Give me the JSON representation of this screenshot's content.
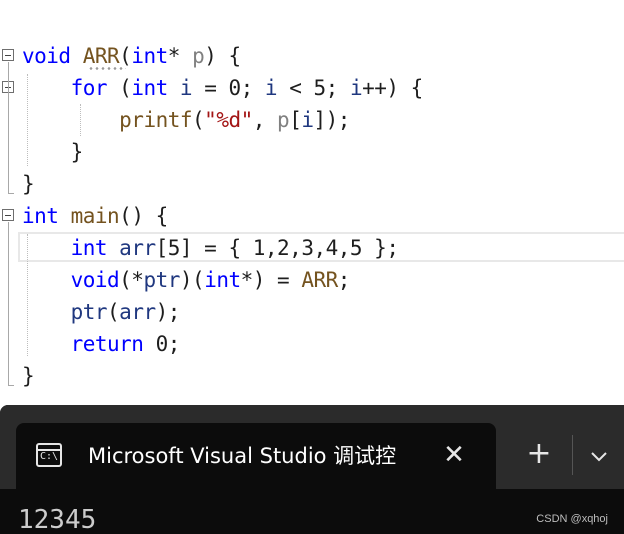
{
  "editor": {
    "lines": [
      {
        "tokens": [
          {
            "t": "void",
            "c": "kw"
          },
          {
            "t": " "
          },
          {
            "t": "ARR",
            "c": "fn"
          },
          {
            "t": "("
          },
          {
            "t": "int",
            "c": "kw"
          },
          {
            "t": "* "
          },
          {
            "t": "p",
            "c": "par"
          },
          {
            "t": ") {"
          }
        ]
      },
      {
        "tokens": [
          {
            "t": "    "
          },
          {
            "t": "for",
            "c": "kw"
          },
          {
            "t": " ("
          },
          {
            "t": "int",
            "c": "kw"
          },
          {
            "t": " "
          },
          {
            "t": "i",
            "c": "var"
          },
          {
            "t": " = 0; "
          },
          {
            "t": "i",
            "c": "var"
          },
          {
            "t": " < 5; "
          },
          {
            "t": "i",
            "c": "var"
          },
          {
            "t": "++) {"
          }
        ]
      },
      {
        "tokens": [
          {
            "t": "        "
          },
          {
            "t": "printf",
            "c": "fn"
          },
          {
            "t": "("
          },
          {
            "t": "\"%d\"",
            "c": "str"
          },
          {
            "t": ", "
          },
          {
            "t": "p",
            "c": "par"
          },
          {
            "t": "["
          },
          {
            "t": "i",
            "c": "var"
          },
          {
            "t": "]);"
          }
        ]
      },
      {
        "tokens": [
          {
            "t": "    }"
          }
        ]
      },
      {
        "tokens": [
          {
            "t": "}"
          }
        ]
      },
      {
        "tokens": [
          {
            "t": "int",
            "c": "kw"
          },
          {
            "t": " "
          },
          {
            "t": "main",
            "c": "fn"
          },
          {
            "t": "() {"
          }
        ]
      },
      {
        "tokens": [
          {
            "t": "    "
          },
          {
            "t": "int",
            "c": "kw"
          },
          {
            "t": " "
          },
          {
            "t": "arr",
            "c": "var"
          },
          {
            "t": "[5] = { 1,2,3,4,5 };"
          }
        ]
      },
      {
        "tokens": [
          {
            "t": "    "
          },
          {
            "t": "void",
            "c": "kw"
          },
          {
            "t": "(*"
          },
          {
            "t": "ptr",
            "c": "var"
          },
          {
            "t": ")("
          },
          {
            "t": "int",
            "c": "kw"
          },
          {
            "t": "*) = "
          },
          {
            "t": "ARR",
            "c": "fn"
          },
          {
            "t": ";"
          }
        ]
      },
      {
        "tokens": [
          {
            "t": "    "
          },
          {
            "t": "ptr",
            "c": "var"
          },
          {
            "t": "("
          },
          {
            "t": "arr",
            "c": "var"
          },
          {
            "t": ");"
          }
        ]
      },
      {
        "tokens": [
          {
            "t": "    "
          },
          {
            "t": "return",
            "c": "kw"
          },
          {
            "t": " 0;"
          }
        ]
      },
      {
        "tokens": [
          {
            "t": "}"
          }
        ]
      }
    ]
  },
  "terminal": {
    "tab_title": "Microsoft Visual Studio 调试控",
    "tab_icon_glyph": "C:\\",
    "close_glyph": "✕",
    "new_tab_glyph": "+",
    "output": "12345",
    "watermark": "CSDN @xqhoj"
  },
  "icons": {
    "tab_icon": "console-icon",
    "close": "close-icon",
    "new_tab": "plus-icon",
    "dropdown": "chevron-down-icon",
    "fold": "collapse-icon"
  },
  "colors": {
    "keyword": "#0000ff",
    "function": "#74531f",
    "string": "#a31515",
    "terminal_bg": "#0c0c0c",
    "tabbar_bg": "#2b2b2b"
  }
}
